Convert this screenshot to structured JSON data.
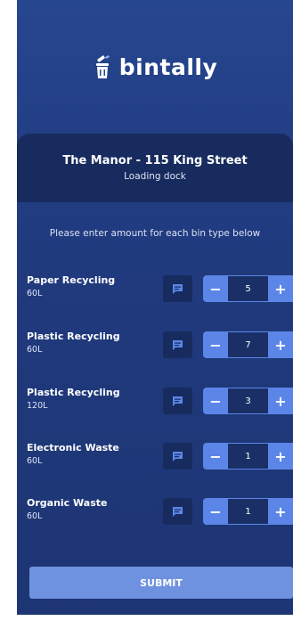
{
  "app": {
    "logo_text": "bintally",
    "logo_icon": "trash-bin-icon"
  },
  "location": {
    "name": "The Manor - 115 King Street",
    "detail": "Loading dock"
  },
  "instructions": "Please enter amount for each bin type below",
  "bins": [
    {
      "name": "Paper Recycling",
      "size": "60L",
      "quantity": "5"
    },
    {
      "name": "Plastic Recycling",
      "size": "60L",
      "quantity": "7"
    },
    {
      "name": "Plastic Recycling",
      "size": "120L",
      "quantity": "3"
    },
    {
      "name": "Electronic Waste",
      "size": "60L",
      "quantity": "1"
    },
    {
      "name": "Organic Waste",
      "size": "60L",
      "quantity": "1"
    }
  ],
  "stepper": {
    "minus": "−",
    "plus": "+"
  },
  "submit_label": "SUBMIT",
  "colors": {
    "background": "#203a7e",
    "card": "#172b5e",
    "accent": "#5b86e8",
    "submit": "#6f92e0"
  }
}
